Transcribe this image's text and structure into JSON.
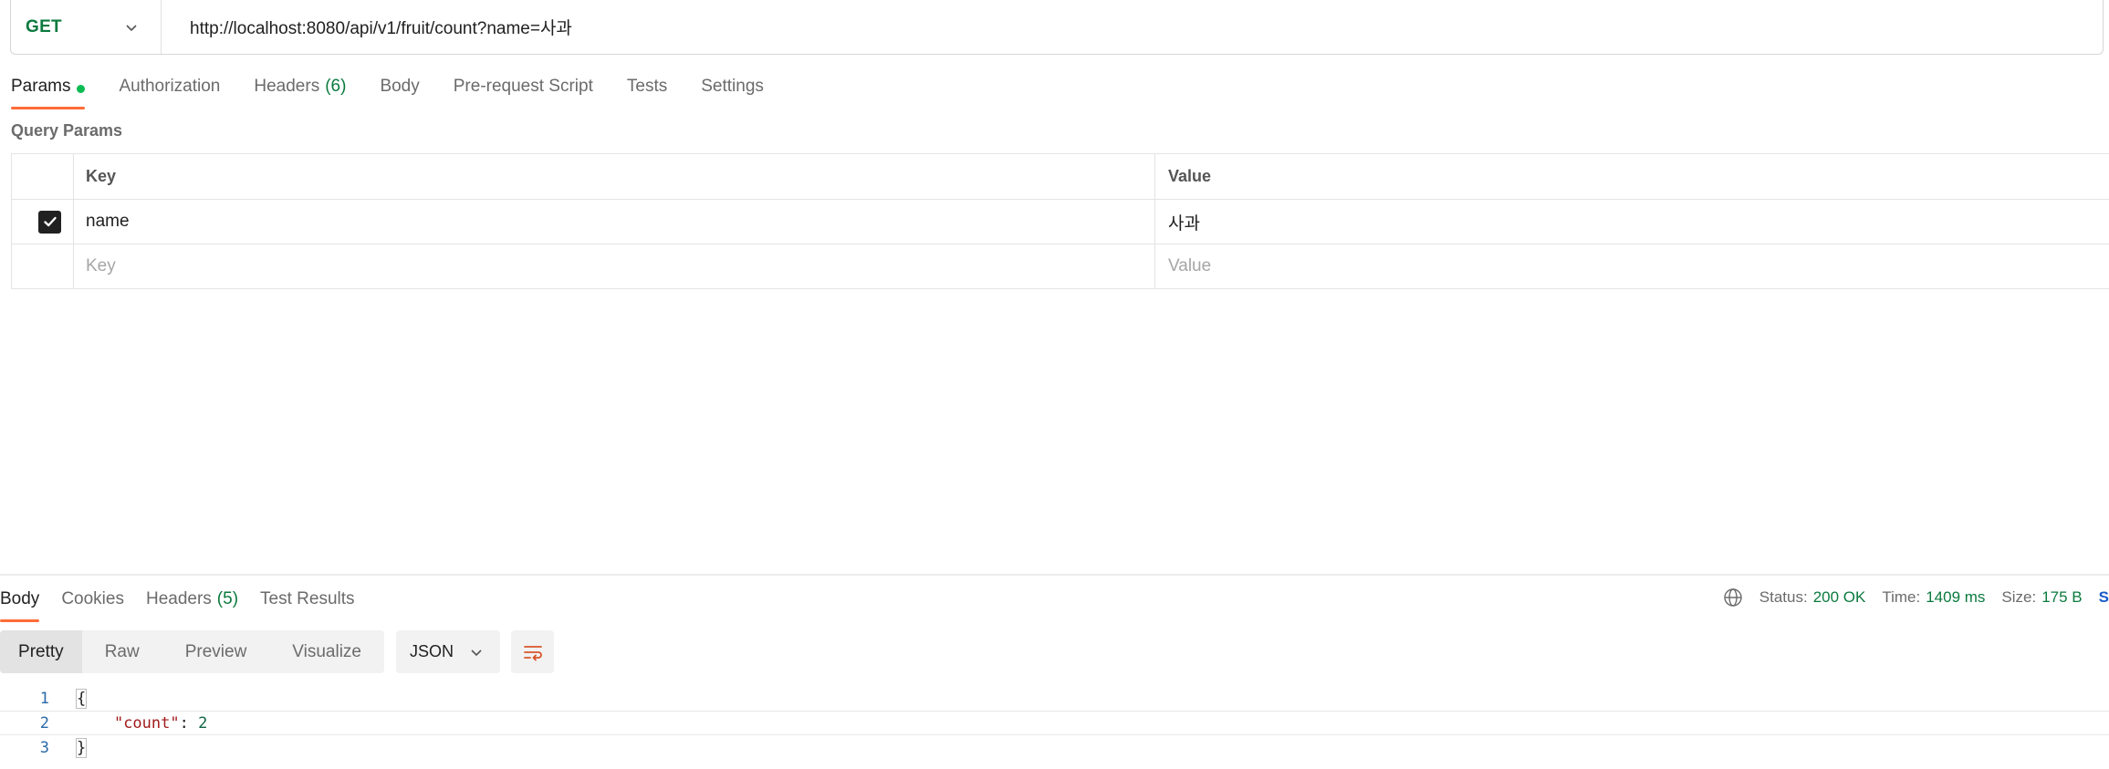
{
  "request": {
    "method": "GET",
    "url": "http://localhost:8080/api/v1/fruit/count?name=사과"
  },
  "request_tabs": {
    "params": "Params",
    "authorization": "Authorization",
    "headers": "Headers",
    "headers_count": "(6)",
    "body": "Body",
    "pre_request": "Pre-request Script",
    "tests": "Tests",
    "settings": "Settings"
  },
  "query_params": {
    "title": "Query Params",
    "col_key": "Key",
    "col_value": "Value",
    "rows": [
      {
        "key": "name",
        "value": "사과",
        "checked": true
      }
    ],
    "placeholder_key": "Key",
    "placeholder_value": "Value"
  },
  "response_tabs": {
    "body": "Body",
    "cookies": "Cookies",
    "headers": "Headers",
    "headers_count": "(5)",
    "test_results": "Test Results"
  },
  "status": {
    "status_label": "Status:",
    "status_value": "200 OK",
    "time_label": "Time:",
    "time_value": "1409 ms",
    "size_label": "Size:",
    "size_value": "175 B",
    "save_partial": "S"
  },
  "view_modes": {
    "pretty": "Pretty",
    "raw": "Raw",
    "preview": "Preview",
    "visualize": "Visualize",
    "format": "JSON"
  },
  "code": {
    "line1_num": "1",
    "line1": "{",
    "line2_num": "2",
    "line2_key": "\"count\"",
    "line2_sep": ": ",
    "line2_val": "2",
    "line3_num": "3",
    "line3": "}"
  },
  "colors": {
    "accent": "#ff6c37",
    "method_get": "#0b7a3e",
    "status_ok": "#0b7a3e",
    "json_key": "#a11b1b",
    "json_number": "#116644"
  }
}
